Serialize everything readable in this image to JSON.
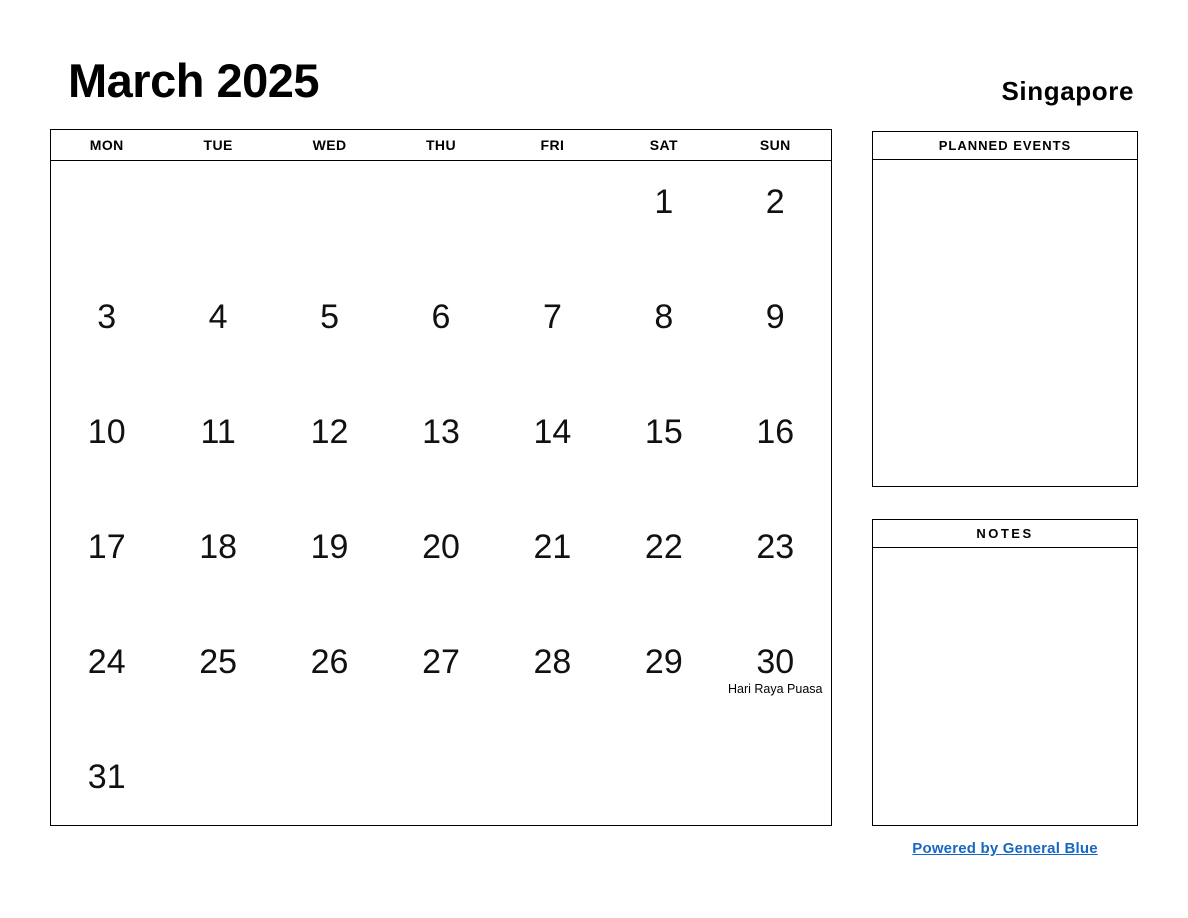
{
  "header": {
    "month_title": "March 2025",
    "country": "Singapore"
  },
  "calendar": {
    "weekdays": [
      "MON",
      "TUE",
      "WED",
      "THU",
      "FRI",
      "SAT",
      "SUN"
    ],
    "weeks": [
      [
        {
          "day": ""
        },
        {
          "day": ""
        },
        {
          "day": ""
        },
        {
          "day": ""
        },
        {
          "day": ""
        },
        {
          "day": "1"
        },
        {
          "day": "2"
        }
      ],
      [
        {
          "day": "3"
        },
        {
          "day": "4"
        },
        {
          "day": "5"
        },
        {
          "day": "6"
        },
        {
          "day": "7"
        },
        {
          "day": "8"
        },
        {
          "day": "9"
        }
      ],
      [
        {
          "day": "10"
        },
        {
          "day": "11"
        },
        {
          "day": "12"
        },
        {
          "day": "13"
        },
        {
          "day": "14"
        },
        {
          "day": "15"
        },
        {
          "day": "16"
        }
      ],
      [
        {
          "day": "17"
        },
        {
          "day": "18"
        },
        {
          "day": "19"
        },
        {
          "day": "20"
        },
        {
          "day": "21"
        },
        {
          "day": "22"
        },
        {
          "day": "23"
        }
      ],
      [
        {
          "day": "24"
        },
        {
          "day": "25"
        },
        {
          "day": "26"
        },
        {
          "day": "27"
        },
        {
          "day": "28"
        },
        {
          "day": "29"
        },
        {
          "day": "30",
          "event": "Hari Raya Puasa"
        }
      ],
      [
        {
          "day": "31"
        },
        {
          "day": ""
        },
        {
          "day": ""
        },
        {
          "day": ""
        },
        {
          "day": ""
        },
        {
          "day": ""
        },
        {
          "day": ""
        }
      ]
    ]
  },
  "panels": {
    "planned_events": {
      "title": "PLANNED EVENTS"
    },
    "notes": {
      "title": "NOTES"
    }
  },
  "footer": {
    "link_label": "Powered by General Blue",
    "link_color": "#1668c4"
  }
}
